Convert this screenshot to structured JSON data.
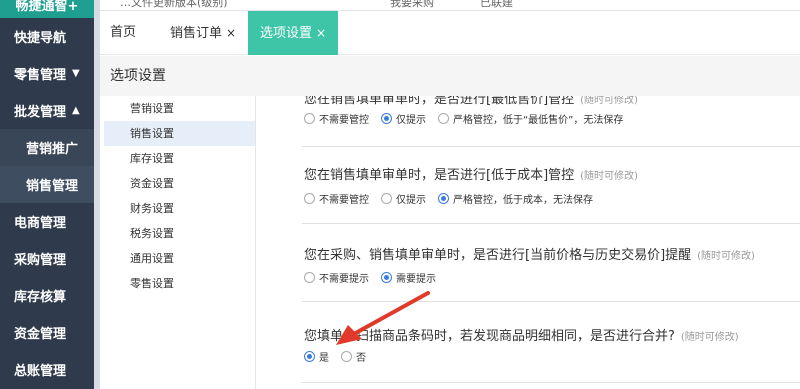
{
  "brand": "畅捷通智+",
  "topbar": {
    "left_text": "…文件更新版本(级别)",
    "right1": "我要采购",
    "right2": "已联建"
  },
  "sidebar": [
    {
      "label": "快捷导航",
      "arrow": ""
    },
    {
      "label": "零售管理",
      "arrow": "▼"
    },
    {
      "label": "批发管理",
      "arrow": "▲"
    },
    {
      "label": "营销推广",
      "arrow": ""
    },
    {
      "label": "销售管理",
      "arrow": ""
    },
    {
      "label": "电商管理",
      "arrow": ""
    },
    {
      "label": "采购管理",
      "arrow": ""
    },
    {
      "label": "库存核算",
      "arrow": ""
    },
    {
      "label": "资金管理",
      "arrow": ""
    },
    {
      "label": "总账管理",
      "arrow": ""
    }
  ],
  "tabs": [
    {
      "label": "首页",
      "close": ""
    },
    {
      "label": "销售订单",
      "close": "×"
    },
    {
      "label": "选项设置",
      "close": "×"
    }
  ],
  "page_title": "选项设置",
  "submenu": [
    "营销设置",
    "销售设置",
    "库存设置",
    "资金设置",
    "财务设置",
    "税务设置",
    "通用设置",
    "零售设置"
  ],
  "settings": [
    {
      "question": "您在销售填单审单时，是否进行[最低售价]管控",
      "note": "(随时可修改)",
      "options": [
        "不需要管控",
        "仅提示",
        "严格管控，低于“最低售价”，无法保存"
      ],
      "selected": 1
    },
    {
      "question": "您在销售填单审单时，是否进行[低于成本]管控",
      "note": "(随时可修改)",
      "options": [
        "不需要管控",
        "仅提示",
        "严格管控，低于成本，无法保存"
      ],
      "selected": 2
    },
    {
      "question": "您在采购、销售填单审单时，是否进行[当前价格与历史交易价]提醒",
      "note": "(随时可修改)",
      "options": [
        "不需要提示",
        "需要提示"
      ],
      "selected": 1
    },
    {
      "question": "您填单，扫描商品条码时，若发现商品明细相同，是否进行合并?",
      "note": "(随时可修改)",
      "options": [
        "是",
        "否"
      ],
      "selected": 0
    }
  ],
  "colors": {
    "sidebar": "#2f3b4c",
    "accent": "#3ec5a8",
    "radio": "#3a7be0",
    "arrow": "#e03a2a"
  }
}
